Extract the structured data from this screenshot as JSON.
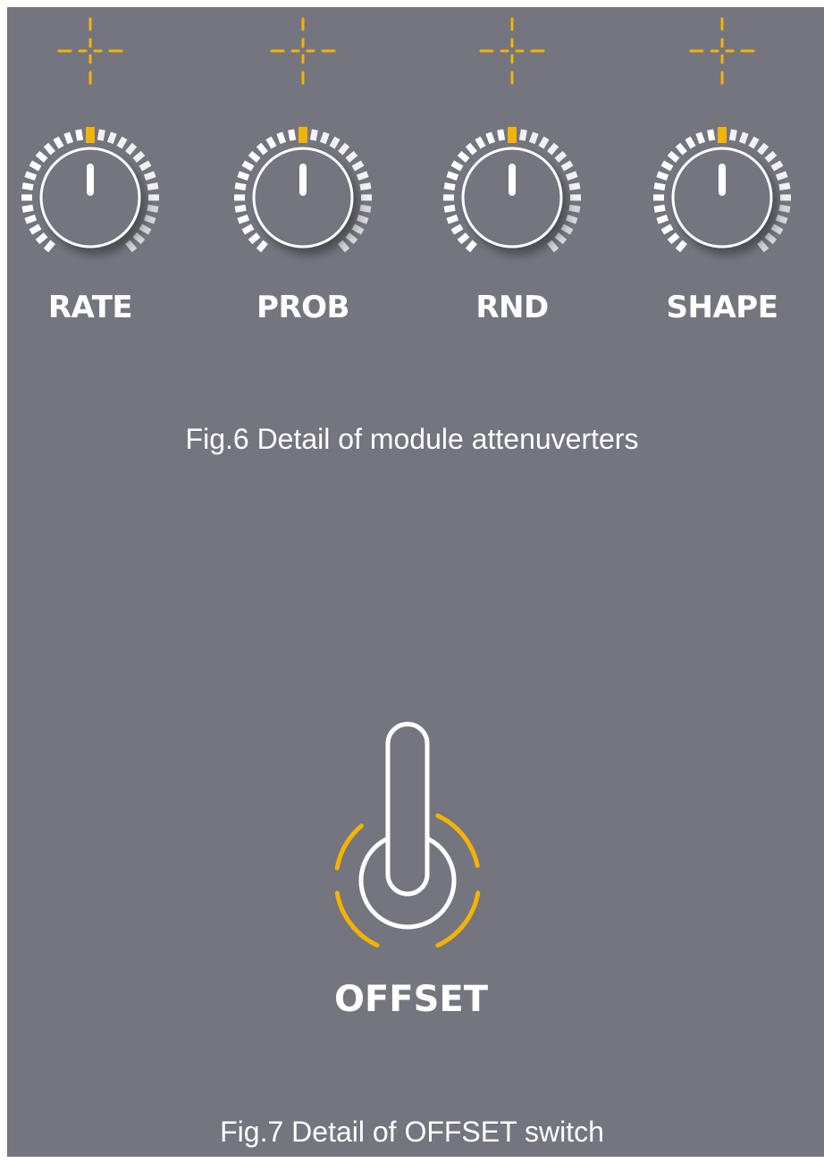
{
  "colors": {
    "panel": "#75757f",
    "accent": "#f3b300",
    "white": "#ffffff"
  },
  "attenuverters": [
    {
      "label": "RATE",
      "icon": "crosshair-icon"
    },
    {
      "label": "PROB",
      "icon": "crosshair-icon"
    },
    {
      "label": "RND",
      "icon": "crosshair-icon"
    },
    {
      "label": "SHAPE",
      "icon": "crosshair-icon"
    }
  ],
  "figure6_caption": "Fig.6  Detail of module attenuverters",
  "offset_switch": {
    "label": "OFFSET",
    "icon": "toggle-switch-icon"
  },
  "figure7_caption": "Fig.7  Detail of OFFSET switch"
}
